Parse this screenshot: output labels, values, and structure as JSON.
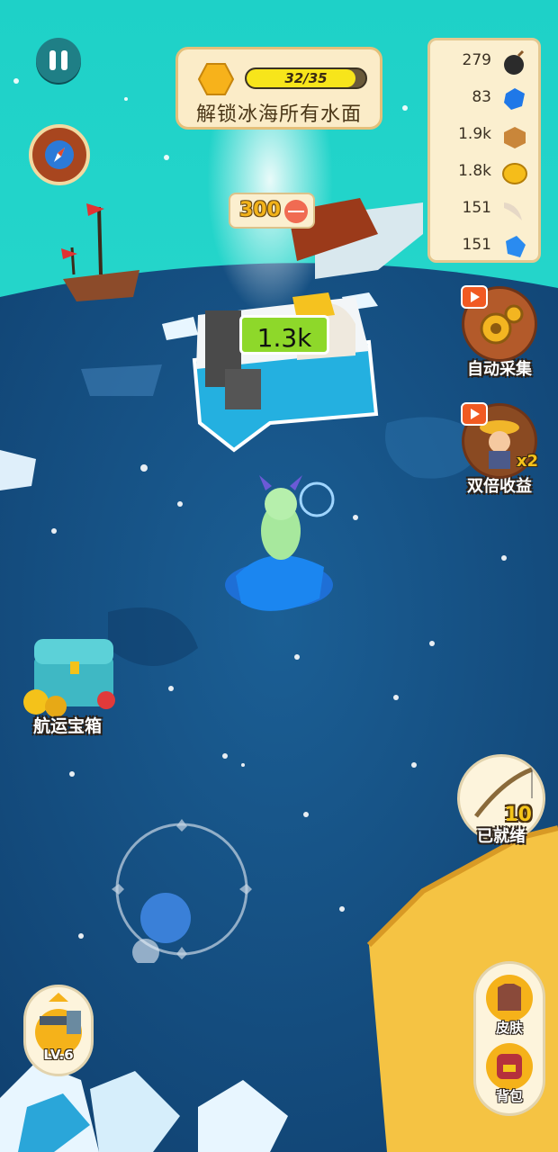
{
  "quest": {
    "progress_text": "32/35",
    "progress_fraction": 0.914,
    "title": "解锁冰海所有水面"
  },
  "resources": [
    {
      "value": "279",
      "icon": "bomb-icon"
    },
    {
      "value": "83",
      "icon": "blue-gem-icon"
    },
    {
      "value": "1.9k",
      "icon": "wood-icon"
    },
    {
      "value": "1.8k",
      "icon": "gold-coin-icon"
    },
    {
      "value": "151",
      "icon": "tusk-icon"
    },
    {
      "value": "151",
      "icon": "ice-crystal-icon"
    }
  ],
  "buttons": {
    "auto_collect": "自动采集",
    "double_income": "双倍收益",
    "double_badge": "x2",
    "shipping_chest": "航运宝箱",
    "rod_ready": "已就绪",
    "rod_count": "10",
    "level": "LV.6",
    "skin": "皮肤",
    "backpack": "背包"
  },
  "world": {
    "price_tag": "300",
    "island_value": "1.3k"
  },
  "colors": {
    "sea": "#124b7c",
    "sky": "#2fd4c6",
    "sand": "#f5c343",
    "panel": "#fbefcf"
  }
}
